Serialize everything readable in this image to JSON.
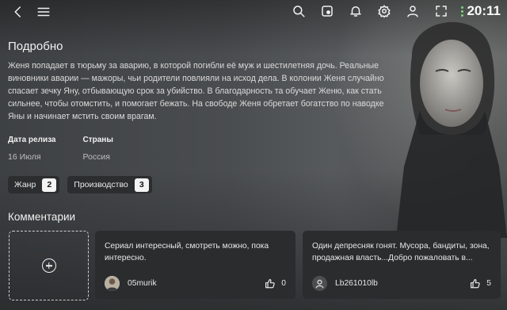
{
  "topbar": {
    "back_icon": "back-arrow-icon",
    "menu_icon": "hamburger-menu-icon",
    "icons": [
      "search-icon",
      "cast-icon",
      "bell-icon",
      "gear-icon",
      "user-icon",
      "fullscreen-icon"
    ],
    "time": "20:11"
  },
  "details": {
    "title": "Подробно",
    "description": "Женя попадает в тюрьму за аварию, в которой погибли её муж и шестилетняя дочь. Реальные виновники аварии — мажоры, чьи родители повлияли на исход дела. В колонии Женя случайно спасает зечку Яну, отбывающую срок за убийство. В благодарность та обучает Женю, как стать сильнее, чтобы отомстить, и помогает бежать. На свободе Женя обретает богатство по наводке Яны и начинает мстить своим врагам.",
    "release_label": "Дата релиза",
    "release_value": "16 Июля",
    "country_label": "Страны",
    "country_value": "Россия"
  },
  "chips": [
    {
      "label": "Жанр",
      "count": "2"
    },
    {
      "label": "Производство",
      "count": "3"
    }
  ],
  "comments": {
    "title": "Комментарии",
    "items": [
      {
        "text": "Сериал интересный, смотреть можно, пока интересно.",
        "user": "05murik",
        "likes": "0"
      },
      {
        "text": "Один депресняк гонят. Мусора, бандиты, зона, продажная власть...Добро пожаловать в...",
        "user": "Lb261010lb",
        "likes": "5"
      }
    ]
  },
  "colors": {
    "status_dot": "#7cd37c",
    "card_bg": "#2a2c2e"
  }
}
